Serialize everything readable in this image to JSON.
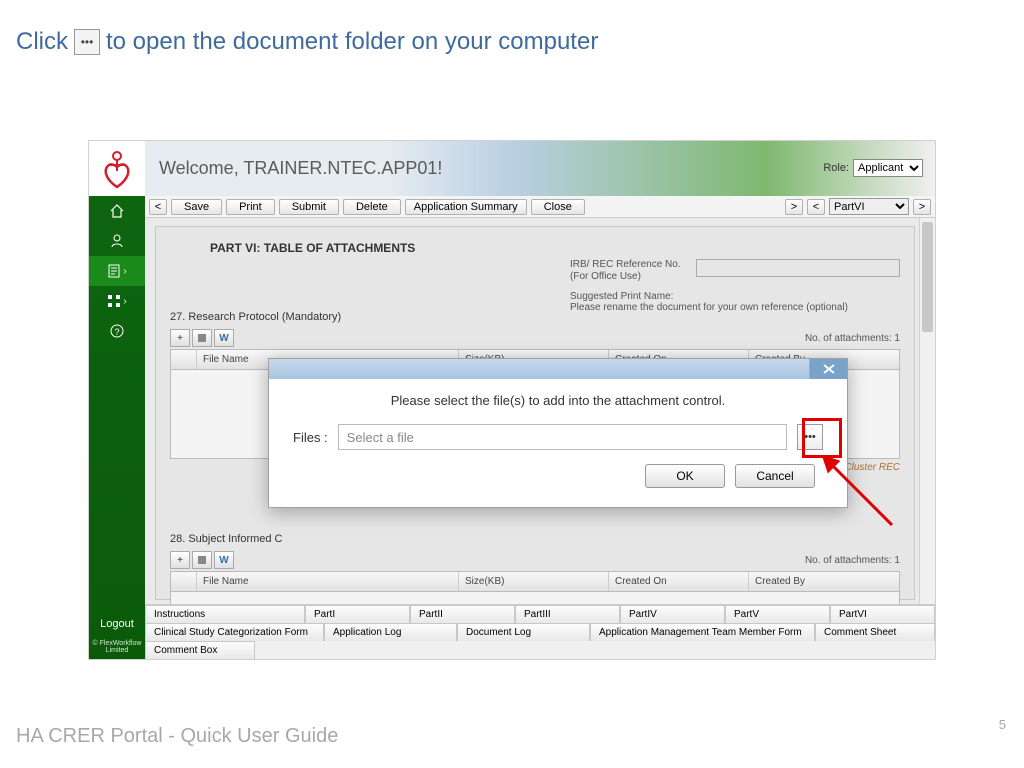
{
  "instruction": {
    "prefix": "Click",
    "suffix": "to open the document folder on your computer"
  },
  "banner": {
    "welcome": "Welcome, TRAINER.NTEC.APP01!",
    "role_label": "Role:",
    "role_value": "Applicant"
  },
  "toolbar": {
    "save": "Save",
    "print": "Print",
    "submit": "Submit",
    "delete": "Delete",
    "summary": "Application Summary",
    "close": "Close",
    "section_select": "PartVI"
  },
  "form": {
    "title": "PART VI: TABLE OF ATTACHMENTS",
    "ref_label1": "IRB/ REC Reference No.",
    "ref_label2": "(For Office Use)",
    "sugg1": "Suggested Print Name:",
    "sugg2": "Please rename the document for your own reference (optional)",
    "q27": "27. Research Protocol (Mandatory)",
    "q28": "28. Subject Informed C",
    "count": "No. of attachments: 1",
    "annot": "ed by Cluster REC",
    "cols": {
      "c1": "File Name",
      "c2": "Size(KB)",
      "c3": "Created On",
      "c4": "Created By"
    }
  },
  "modal": {
    "text": "Please select the file(s) to add into the attachment control.",
    "files_label": "Files :",
    "placeholder": "Select a file",
    "ok": "OK",
    "cancel": "Cancel"
  },
  "sidebar": {
    "logout": "Logout",
    "copyright": "© FlexWorkflow Limited"
  },
  "tabs_row1": [
    "Instructions",
    "PartI",
    "PartII",
    "PartIII",
    "PartIV",
    "PartV",
    "PartVI"
  ],
  "tabs_row2": [
    "Clinical Study Categorization Form",
    "Application Log",
    "Document Log",
    "Application Management Team Member Form",
    "Comment Sheet"
  ],
  "tabs_row3": "Comment Box",
  "footer": "HA CRER Portal - Quick User Guide",
  "page_num": "5"
}
